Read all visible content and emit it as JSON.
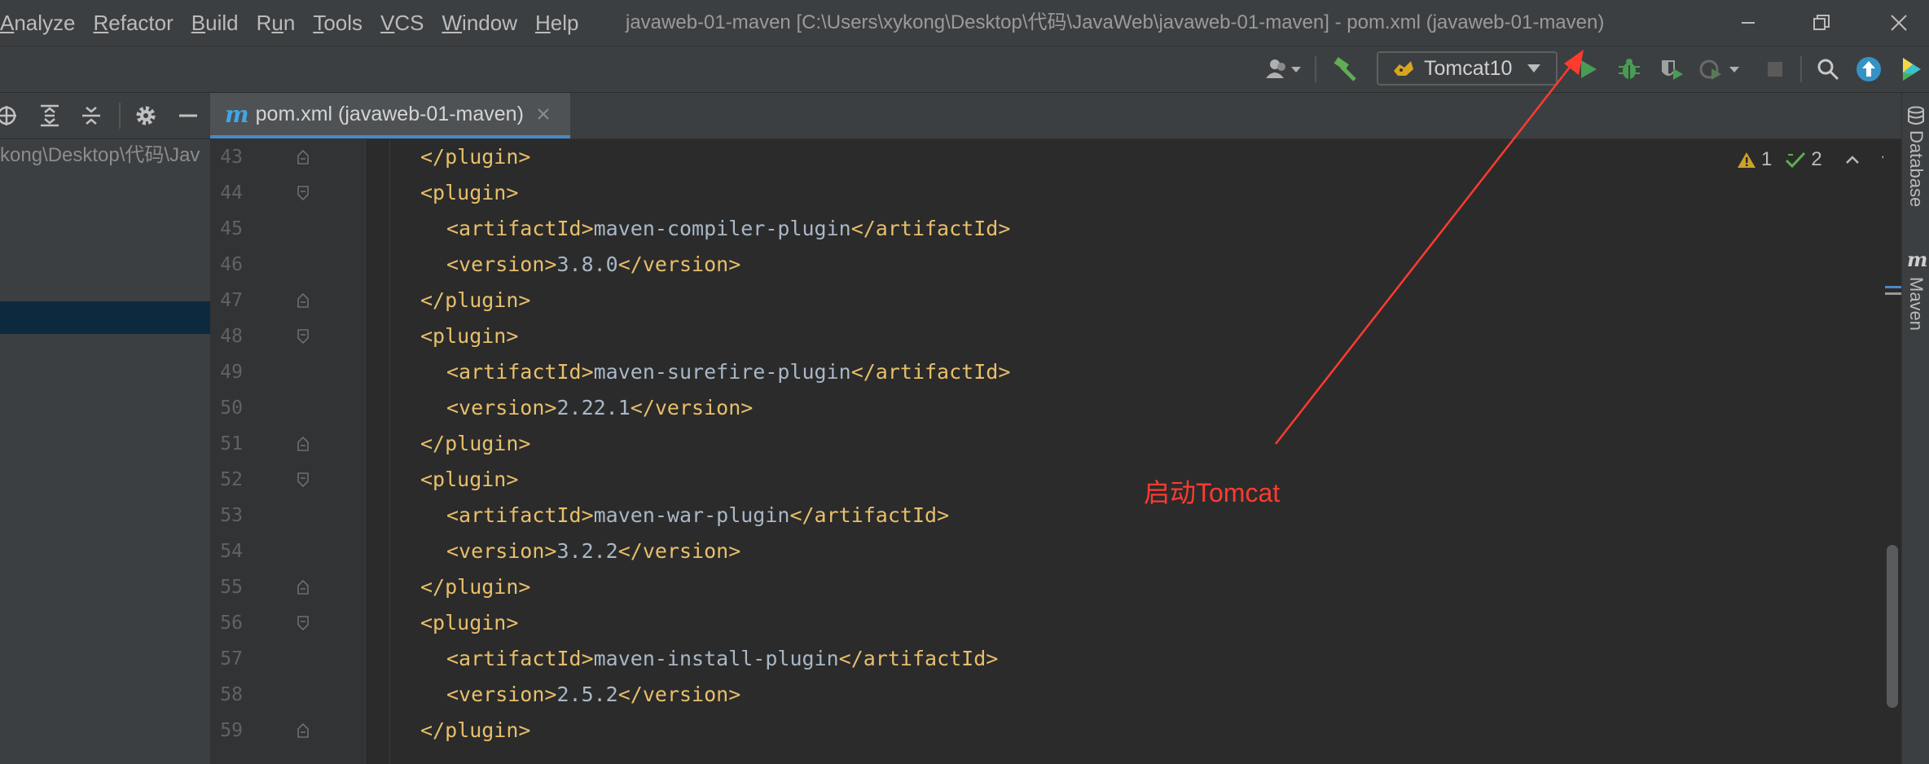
{
  "menu": [
    {
      "label": "Analyze",
      "mnemonic": "A",
      "rest": "nalyze"
    },
    {
      "label": "Refactor",
      "mnemonic": "R",
      "rest": "efactor"
    },
    {
      "label": "Build",
      "mnemonic": "B",
      "rest": "uild"
    },
    {
      "label": "Run",
      "pre": "R",
      "mnemonic": "u",
      "rest": "n"
    },
    {
      "label": "Tools",
      "mnemonic": "T",
      "rest": "ools"
    },
    {
      "label": "VCS",
      "mnemonic": "V",
      "rest": "CS"
    },
    {
      "label": "Window",
      "mnemonic": "W",
      "rest": "indow"
    },
    {
      "label": "Help",
      "mnemonic": "H",
      "rest": "elp"
    }
  ],
  "window_title": "javaweb-01-maven [C:\\Users\\xykong\\Desktop\\代码\\JavaWeb\\javaweb-01-maven] - pom.xml (javaweb-01-maven)",
  "toolbar": {
    "run_config": "Tomcat10"
  },
  "project": {
    "path": "kong\\Desktop\\代码\\Jav"
  },
  "editor": {
    "tab_label": "pom.xml (javaweb-01-maven)",
    "warnings_count": "1",
    "checks_count": "2",
    "lines": [
      {
        "no": "43",
        "indent": 1,
        "open": "</plugin>",
        "text": "",
        "close": ""
      },
      {
        "no": "44",
        "indent": 1,
        "open": "<plugin>",
        "text": "",
        "close": ""
      },
      {
        "no": "45",
        "indent": 2,
        "open": "<artifactId>",
        "text": "maven-compiler-plugin",
        "close": "</artifactId>"
      },
      {
        "no": "46",
        "indent": 2,
        "open": "<version>",
        "text": "3.8.0",
        "close": "</version>"
      },
      {
        "no": "47",
        "indent": 1,
        "open": "</plugin>",
        "text": "",
        "close": ""
      },
      {
        "no": "48",
        "indent": 1,
        "open": "<plugin>",
        "text": "",
        "close": ""
      },
      {
        "no": "49",
        "indent": 2,
        "open": "<artifactId>",
        "text": "maven-surefire-plugin",
        "close": "</artifactId>"
      },
      {
        "no": "50",
        "indent": 2,
        "open": "<version>",
        "text": "2.22.1",
        "close": "</version>"
      },
      {
        "no": "51",
        "indent": 1,
        "open": "</plugin>",
        "text": "",
        "close": ""
      },
      {
        "no": "52",
        "indent": 1,
        "open": "<plugin>",
        "text": "",
        "close": ""
      },
      {
        "no": "53",
        "indent": 2,
        "open": "<artifactId>",
        "text": "maven-war-plugin",
        "close": "</artifactId>"
      },
      {
        "no": "54",
        "indent": 2,
        "open": "<version>",
        "text": "3.2.2",
        "close": "</version>"
      },
      {
        "no": "55",
        "indent": 1,
        "open": "</plugin>",
        "text": "",
        "close": ""
      },
      {
        "no": "56",
        "indent": 1,
        "open": "<plugin>",
        "text": "",
        "close": ""
      },
      {
        "no": "57",
        "indent": 2,
        "open": "<artifactId>",
        "text": "maven-install-plugin",
        "close": "</artifactId>"
      },
      {
        "no": "58",
        "indent": 2,
        "open": "<version>",
        "text": "2.5.2",
        "close": "</version>"
      },
      {
        "no": "59",
        "indent": 1,
        "open": "</plugin>",
        "text": "",
        "close": ""
      }
    ]
  },
  "side_tabs": {
    "database": "Database",
    "maven": "Maven"
  },
  "annotation": {
    "text": "启动Tomcat"
  },
  "colors": {
    "tag": "#e8bf6a",
    "text": "#a9b7c6",
    "run_green": "#499c54",
    "annotation_red": "#ff3b30",
    "accent_blue": "#4a88c7"
  }
}
